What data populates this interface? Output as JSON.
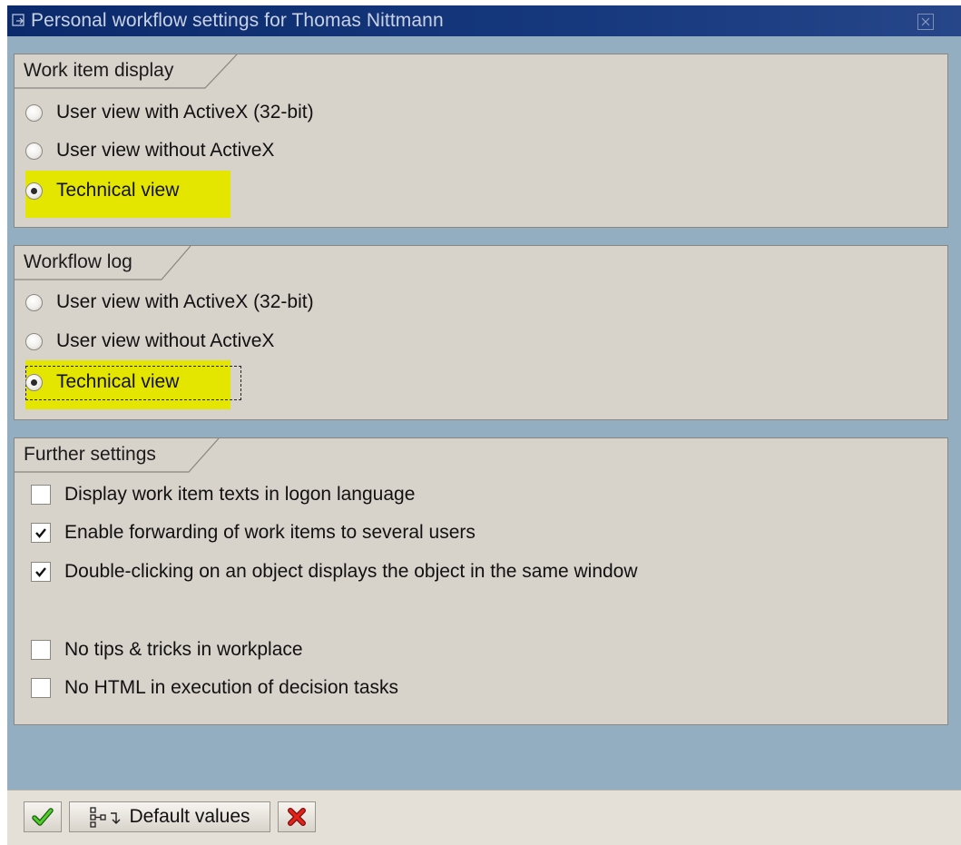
{
  "window": {
    "title": "Personal workflow settings for Thomas Nittmann"
  },
  "groups": {
    "work_item_display": {
      "title": "Work item display",
      "options": [
        {
          "label": "User view with ActiveX (32-bit)",
          "selected": false
        },
        {
          "label": "User view without ActiveX",
          "selected": false
        },
        {
          "label": "Technical view",
          "selected": true
        }
      ]
    },
    "workflow_log": {
      "title": "Workflow log",
      "options": [
        {
          "label": "User view with ActiveX (32-bit)",
          "selected": false
        },
        {
          "label": "User view without ActiveX",
          "selected": false
        },
        {
          "label": "Technical view",
          "selected": true
        }
      ]
    },
    "further_settings": {
      "title": "Further settings",
      "checkboxes": [
        {
          "label": "Display work item texts in logon language",
          "checked": false
        },
        {
          "label": "Enable forwarding of work items to several users",
          "checked": true
        },
        {
          "label": "Double-clicking on an object displays the object in the same window",
          "checked": true
        },
        {
          "label": "No tips & tricks in workplace",
          "checked": false
        },
        {
          "label": "No HTML in execution of decision tasks",
          "checked": false
        }
      ]
    }
  },
  "toolbar": {
    "confirm_icon": "green-checkmark-icon",
    "default_values_label": "Default values",
    "cancel_icon": "red-x-icon"
  },
  "colors": {
    "highlight": "#e5e600",
    "titlebar": "#0b2a6c",
    "background": "#93adc1",
    "panel": "#d7d2ca"
  }
}
